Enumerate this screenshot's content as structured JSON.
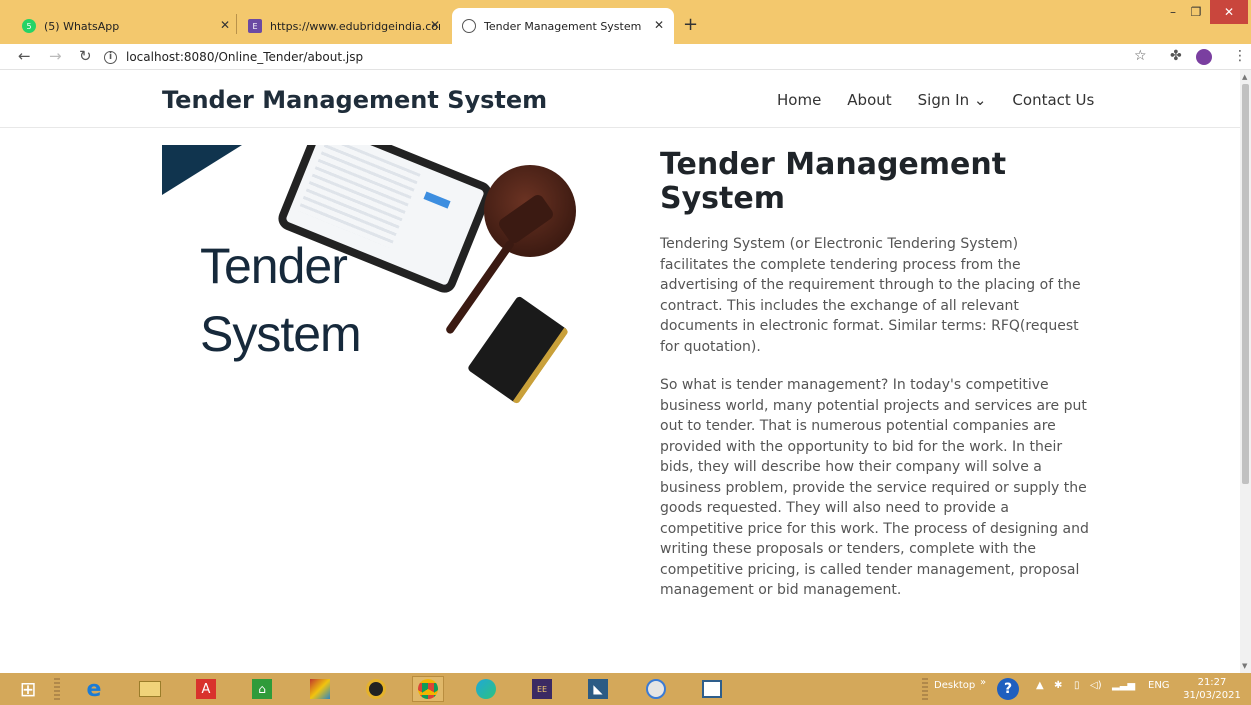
{
  "browser": {
    "tabs": [
      {
        "title": "(5) WhatsApp",
        "icon": "whatsapp-icon"
      },
      {
        "title": "https://www.edubridgeindia.com",
        "icon": "edubridge-icon"
      },
      {
        "title": "Tender Management System",
        "icon": "globe-icon",
        "active": true
      }
    ],
    "new_tab": "+",
    "url": "localhost:8080/Online_Tender/about.jsp"
  },
  "site": {
    "brand": "Tender Management System",
    "nav": {
      "home": "Home",
      "about": "About",
      "sign_in": "Sign In ⌄",
      "contact": "Contact Us"
    }
  },
  "hero_image": {
    "line1": "Tender",
    "line2": "System"
  },
  "article": {
    "title": "Tender Management System",
    "paragraph1": "Tendering System (or Electronic Tendering System) facilitates the complete tendering process from the advertising of the requirement through to the placing of the contract. This includes the exchange of all relevant documents in electronic format. Similar terms: RFQ(request for quotation).",
    "paragraph2": "So what is tender management? In today's competitive business world, many potential projects and services are put out to tender. That is numerous potential companies are provided with the opportunity to bid for the work. In their bids, they will describe how their company will solve a business problem, provide the service required or supply the goods requested. They will also need to provide a competitive price for this work. The process of designing and writing these proposals or tenders, complete with the competitive pricing, is called tender management, proposal management or bid management."
  },
  "taskbar": {
    "desktop_label": "Desktop",
    "language": "ENG",
    "time": "21:27",
    "date": "31/03/2021"
  },
  "colors": {
    "tabstrip": "#f3c86d",
    "taskbar": "#d4a85a",
    "brand_text": "#1f2d3a",
    "hero_triangle": "#10344e"
  }
}
